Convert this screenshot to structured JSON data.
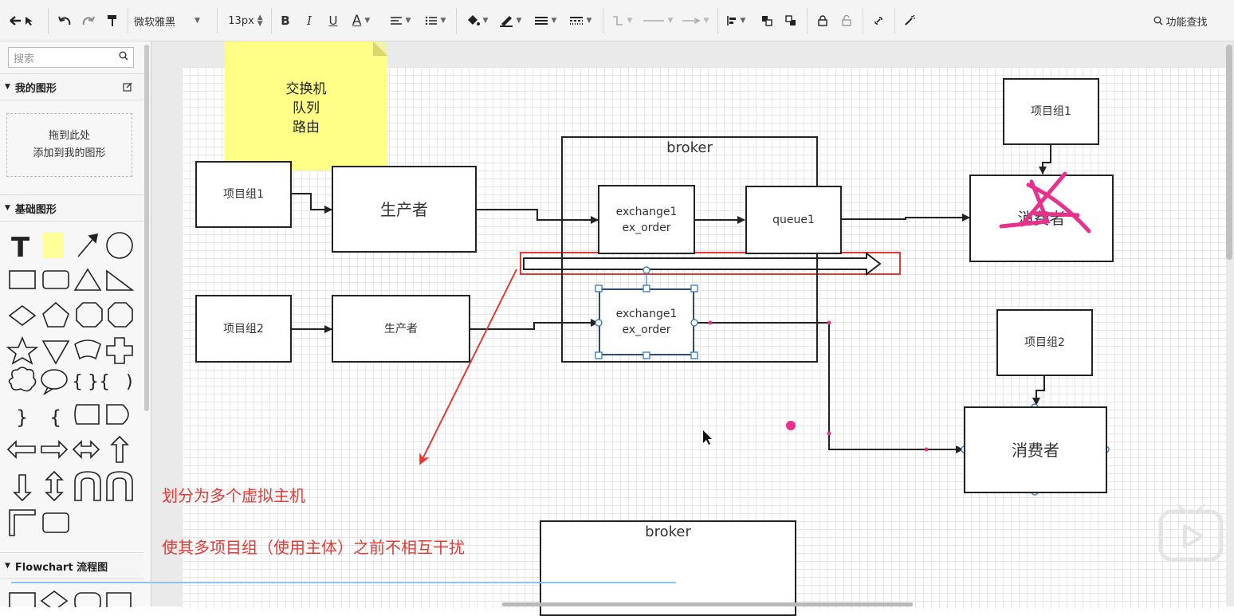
{
  "toolbar": {
    "font_family": "微软雅黑",
    "font_size": "13px",
    "bold": "B",
    "italic": "I",
    "underline": "U",
    "font_color": "A",
    "find_label": "功能查找"
  },
  "sidebar": {
    "search_placeholder": "搜索",
    "my_shapes": "我的图形",
    "drop_line1": "拖到此处",
    "drop_line2": "添加到我的图形",
    "basic_shapes": "基础图形",
    "flowchart": "Flowchart 流程图"
  },
  "diagram": {
    "note_lines": [
      "交换机",
      "队列",
      "路由"
    ],
    "group1_left": "项目组1",
    "producer1": "生产者",
    "group2_left": "项目组2",
    "producer2": "生产者",
    "broker1": "broker",
    "exchange_top": [
      "exchange1",
      "ex_order"
    ],
    "queue1": "queue1",
    "exchange_bottom": [
      "exchange1",
      "ex_order"
    ],
    "group1_right": "项目组1",
    "consumer1": "消费者",
    "group2_right": "项目组2",
    "consumer2": "消费者",
    "broker2": "broker",
    "annotation1": "划分为多个虚拟主机",
    "annotation2": "使其多项目组（使用主体）之前不相互干扰"
  },
  "colors": {
    "annotation_red": "#e53935",
    "pink_mark": "#e8318c",
    "selection_blue": "#3f7fc9"
  }
}
